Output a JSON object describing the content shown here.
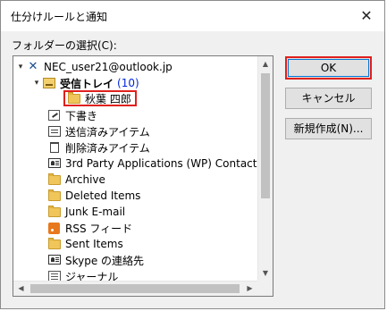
{
  "dialog": {
    "title": "仕分けルールと通知",
    "close_symbol": "✕",
    "folder_select_label": "フォルダーの選択(C):"
  },
  "tree": {
    "account": "NEC_user21@outlook.jp",
    "inbox": "受信トレイ",
    "inbox_count": "(10)",
    "subfolder": "秋葉 四郎",
    "folders": [
      {
        "label": "下書き",
        "icon": "draft-icon"
      },
      {
        "label": "送信済みアイテム",
        "icon": "sent-items-icon"
      },
      {
        "label": "削除済みアイテム",
        "icon": "trash-icon"
      },
      {
        "label": "3rd Party Applications (WP) Contact",
        "icon": "contacts-icon"
      },
      {
        "label": "Archive",
        "icon": "folder-icon"
      },
      {
        "label": "Deleted Items",
        "icon": "folder-icon"
      },
      {
        "label": "Junk E-mail",
        "icon": "folder-icon"
      },
      {
        "label": "RSS フィード",
        "icon": "rss-icon"
      },
      {
        "label": "Sent Items",
        "icon": "folder-icon"
      },
      {
        "label": "Skype の連絡先",
        "icon": "contacts-icon"
      },
      {
        "label": "ジャーナル",
        "icon": "journal-icon"
      }
    ]
  },
  "buttons": {
    "ok": "OK",
    "cancel": "キャンセル",
    "new": "新規作成(N)..."
  },
  "colors": {
    "highlight_border": "#e0201c",
    "count_text": "#0026d9",
    "dialog_bg": "#f0f0f0"
  }
}
